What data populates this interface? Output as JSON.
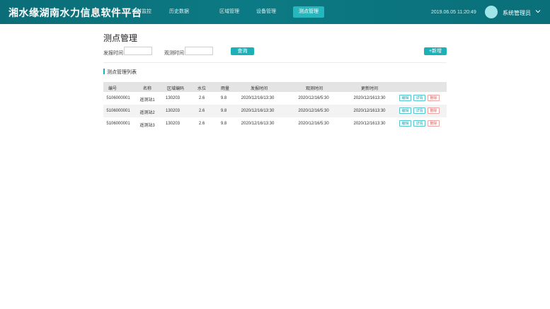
{
  "header": {
    "app_title": "湘水缘湖南水力信息软件平台",
    "nav": [
      {
        "label": "实时监控",
        "active": false
      },
      {
        "label": "历史数据",
        "active": false
      },
      {
        "label": "区域管理",
        "active": false
      },
      {
        "label": "设备管理",
        "active": false
      },
      {
        "label": "测点管理",
        "active": true
      }
    ],
    "datetime": "2019.06.05 11:20:49",
    "user": "系统管理员",
    "colors": {
      "bar": "#0c7a84",
      "accent": "#26b6bd"
    }
  },
  "page": {
    "title": "测点管理",
    "filters": {
      "send_time_label": "发报时间",
      "send_time_value": "",
      "observe_time_label": "观测时间",
      "observe_time_value": ""
    },
    "query_label": "查询",
    "add_label": "+新增",
    "section_title": "测点管理列表"
  },
  "table": {
    "columns": [
      "编号",
      "名称",
      "区域编码",
      "水位",
      "雨量",
      "发报时间",
      "观测时间",
      "更新时间"
    ],
    "rows": [
      [
        "5106000001",
        "遥测站1",
        "130203",
        "2.6",
        "9.8",
        "2020/12/16/13:30",
        "2020/12/16/5:30",
        "2020/12/1613:30"
      ],
      [
        "5106000001",
        "遥测站2",
        "130203",
        "2.6",
        "9.8",
        "2020/12/16/13:30",
        "2020/12/16/5:30",
        "2020/12/1613:30"
      ],
      [
        "5106000001",
        "遥测站3",
        "130203",
        "2.6",
        "9.8",
        "2020/12/16/13:30",
        "2020/12/16/5:30",
        "2020/12/1613:30"
      ]
    ],
    "actions": {
      "edit": "编辑",
      "detail": "详情",
      "delete": "删除"
    }
  }
}
